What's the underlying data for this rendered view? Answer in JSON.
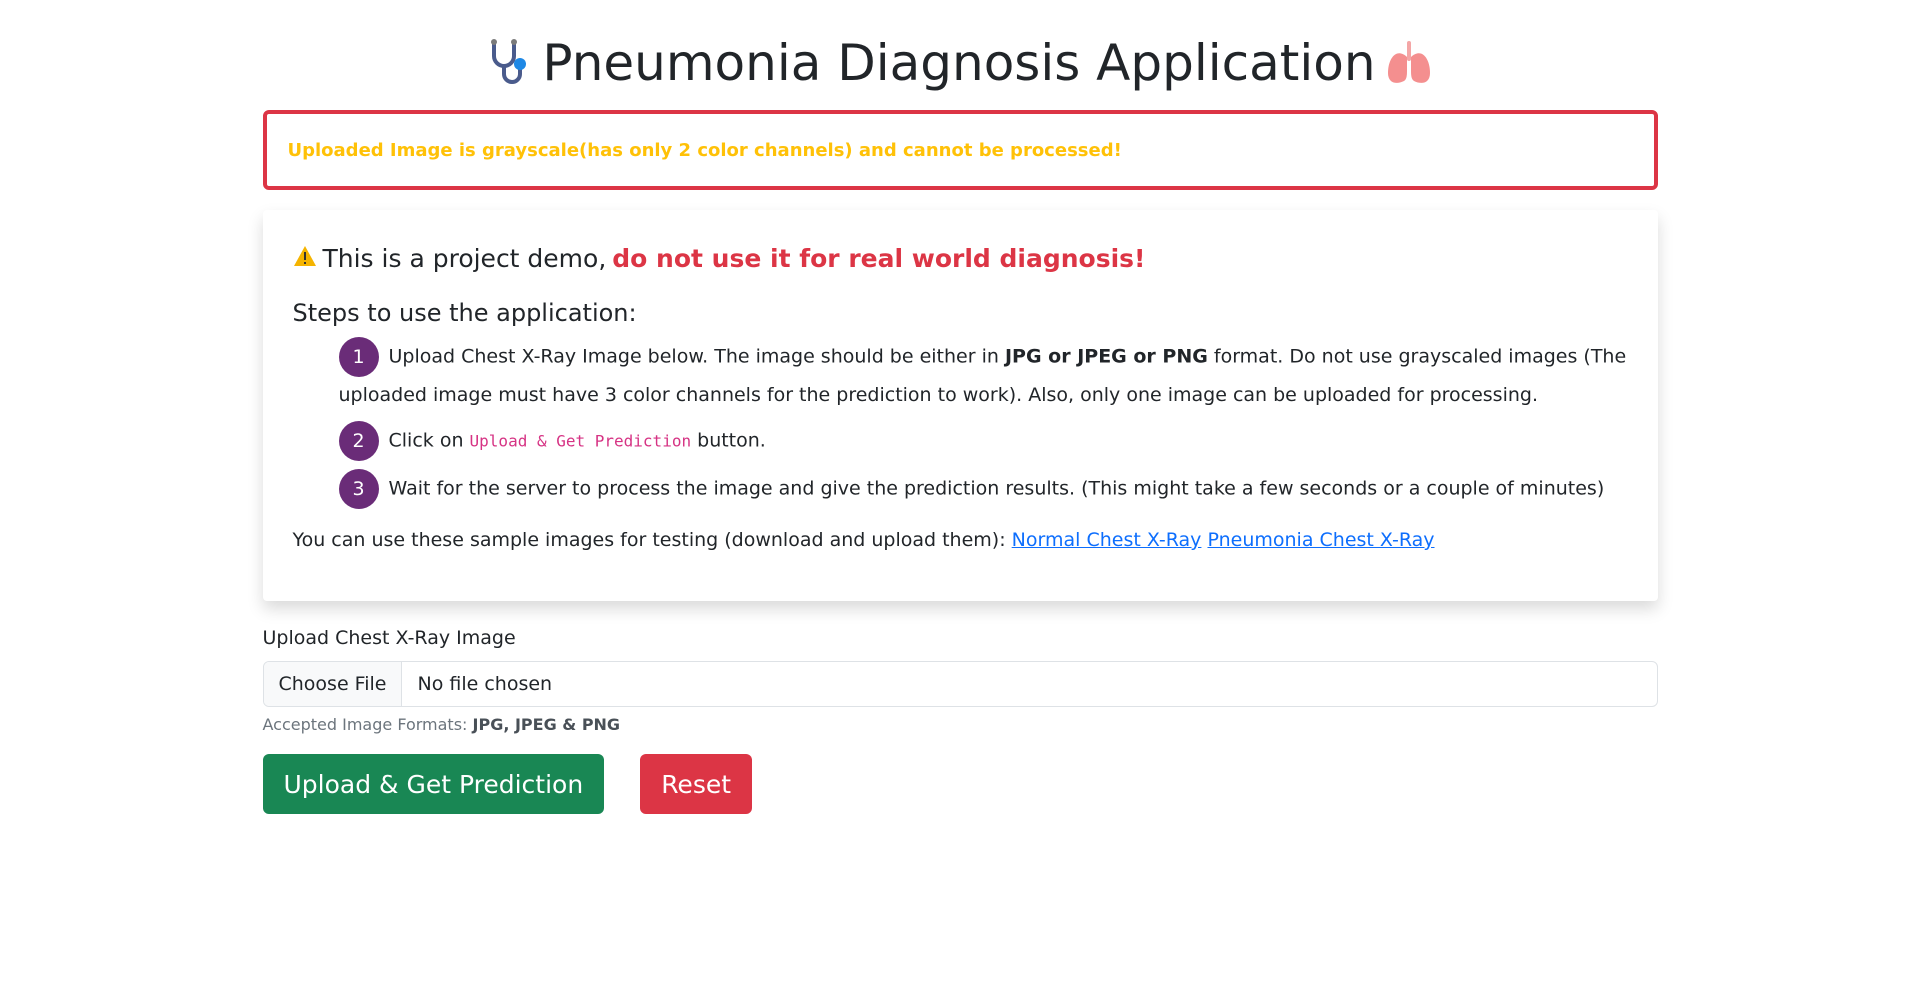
{
  "header": {
    "title": "Pneumonia Diagnosis Application"
  },
  "alert": {
    "message": "Uploaded Image is grayscale(has only 2 color channels) and cannot be processed!"
  },
  "info": {
    "warning_prefix": "This is a project demo, ",
    "warning_emphasis": "do not use it for real world diagnosis!",
    "steps_title": "Steps to use the application:",
    "steps": [
      {
        "num": "1",
        "before": "Upload Chest X-Ray Image below. The image should be either in ",
        "bold": "JPG or JPEG or PNG",
        "after": " format. Do not use grayscaled images (The uploaded image must have 3 color channels for the prediction to work). Also, only one image can be uploaded for processing."
      },
      {
        "num": "2",
        "before": "Click on ",
        "code": "Upload & Get Prediction",
        "after": " button."
      },
      {
        "num": "3",
        "text": "Wait for the server to process the image and give the prediction results. (This might take a few seconds or a couple of minutes)"
      }
    ],
    "samples_text": "You can use these sample images for testing (download and upload them): ",
    "sample_links": [
      "Normal Chest X-Ray",
      "Pneumonia Chest X-Ray"
    ]
  },
  "upload": {
    "label": "Upload Chest X-Ray Image",
    "choose_button": "Choose File",
    "status": "No file chosen",
    "formats_prefix": "Accepted Image Formats: ",
    "formats_value": "JPG, JPEG & PNG"
  },
  "actions": {
    "submit_label": "Upload & Get Prediction",
    "reset_label": "Reset"
  },
  "colors": {
    "alert_border": "#dc3545",
    "alert_text": "#ffc107",
    "step_badge": "#6a2c78",
    "success_button": "#198754",
    "danger_button": "#dc3545",
    "link": "#0d6efd"
  },
  "icons": {
    "title_left": "stethoscope-icon",
    "title_right": "lungs-icon",
    "warning": "warning-icon"
  }
}
